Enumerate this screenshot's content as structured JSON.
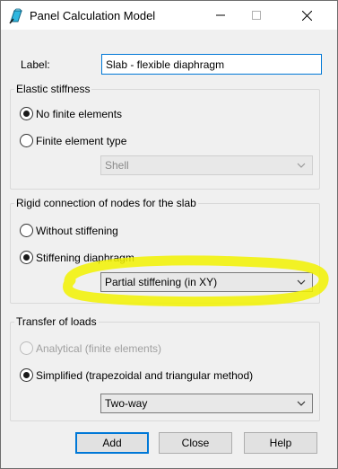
{
  "window": {
    "title": "Panel Calculation Model",
    "accent_color": "#0078d7",
    "highlight_color": "#f2f200"
  },
  "label_field": {
    "label": "Label:",
    "value": "Slab - flexible diaphragm"
  },
  "elastic_stiffness": {
    "title": "Elastic stiffness",
    "option_no_fe": "No finite elements",
    "option_fe_type": "Finite element type",
    "selected": "No finite elements",
    "fe_type_select": "Shell"
  },
  "rigid_connection": {
    "title": "Rigid connection of nodes for the slab",
    "option_without": "Without stiffening",
    "option_diaphragm": "Stiffening diaphragm",
    "selected": "Stiffening diaphragm",
    "diaphragm_select": "Partial stiffening (in XY)"
  },
  "transfer_of_loads": {
    "title": "Transfer of loads",
    "option_analytical": "Analytical (finite elements)",
    "option_simplified": "Simplified (trapezoidal and triangular method)",
    "selected": "Simplified (trapezoidal and triangular method)",
    "method_select": "Two-way"
  },
  "buttons": {
    "add": "Add",
    "close": "Close",
    "help": "Help"
  }
}
